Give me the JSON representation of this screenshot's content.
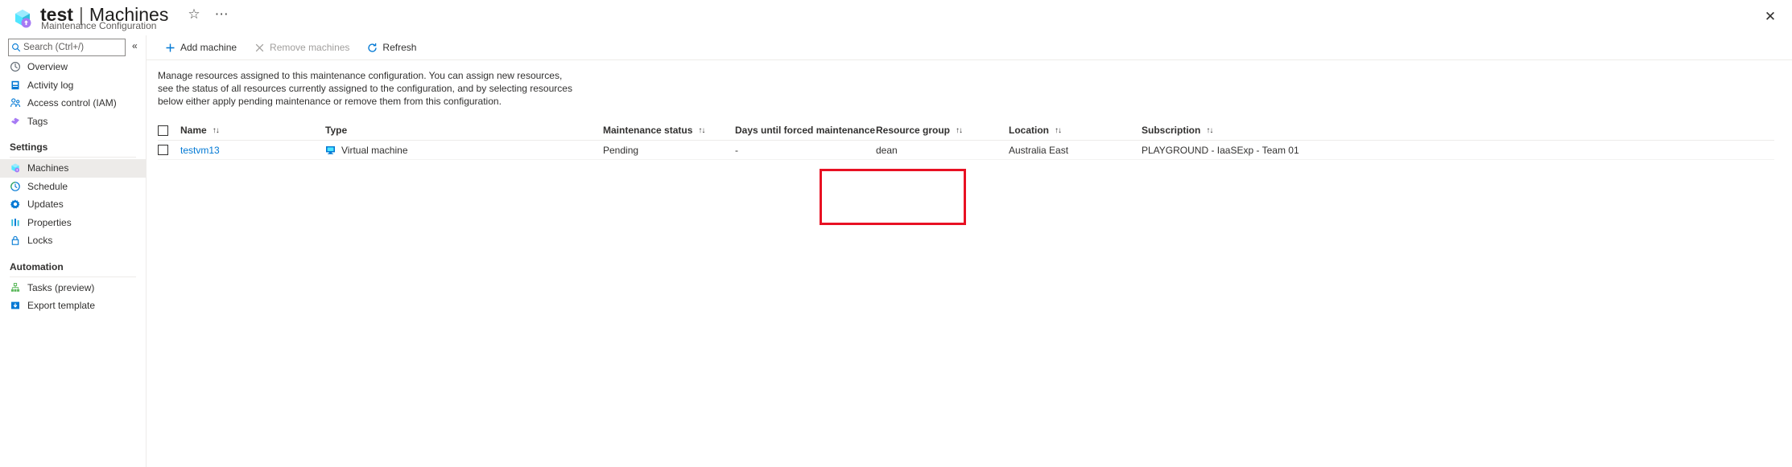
{
  "header": {
    "resource_icon": "maintenance-configuration-icon",
    "title": "test",
    "separator": "|",
    "section": "Machines",
    "subtitle": "Maintenance Configuration",
    "favorite_icon": "star-icon",
    "more_icon": "ellipsis-icon",
    "close_icon": "close-icon"
  },
  "sidebar": {
    "search": {
      "placeholder": "Search (Ctrl+/)",
      "value": "",
      "icon": "search-icon"
    },
    "collapse_icon": "chevron-double-left-icon",
    "items": [
      {
        "label": "Overview",
        "icon": "overview-icon",
        "selected": false
      },
      {
        "label": "Activity log",
        "icon": "activity-log-icon",
        "selected": false
      },
      {
        "label": "Access control (IAM)",
        "icon": "access-control-icon",
        "selected": false
      },
      {
        "label": "Tags",
        "icon": "tags-icon",
        "selected": false
      }
    ],
    "groups": [
      {
        "title": "Settings",
        "items": [
          {
            "label": "Machines",
            "icon": "machines-icon",
            "selected": true
          },
          {
            "label": "Schedule",
            "icon": "schedule-clock-icon",
            "selected": false
          },
          {
            "label": "Updates",
            "icon": "updates-gear-icon",
            "selected": false
          },
          {
            "label": "Properties",
            "icon": "properties-icon",
            "selected": false
          },
          {
            "label": "Locks",
            "icon": "lock-icon",
            "selected": false
          }
        ]
      },
      {
        "title": "Automation",
        "items": [
          {
            "label": "Tasks (preview)",
            "icon": "tasks-icon",
            "selected": false
          },
          {
            "label": "Export template",
            "icon": "export-template-icon",
            "selected": false
          }
        ]
      }
    ]
  },
  "toolbar": {
    "add_machine": {
      "label": "Add machine",
      "icon": "plus-icon",
      "disabled": false
    },
    "remove_machines": {
      "label": "Remove machines",
      "icon": "cross-icon",
      "disabled": true
    },
    "refresh": {
      "label": "Refresh",
      "icon": "refresh-icon",
      "disabled": false
    }
  },
  "description": "Manage resources assigned to this maintenance configuration. You can assign new resources, see the status of all resources currently assigned to the configuration, and by selecting resources below either apply pending maintenance or remove them from this configuration.",
  "table": {
    "sort_icon": "↑↓",
    "select_all_checkbox": false,
    "columns": [
      {
        "key": "name",
        "label": "Name",
        "sortable": true
      },
      {
        "key": "type",
        "label": "Type",
        "sortable": false
      },
      {
        "key": "status",
        "label": "Maintenance status",
        "sortable": true
      },
      {
        "key": "days",
        "label": "Days until forced maintenance",
        "sortable": true
      },
      {
        "key": "resource_group",
        "label": "Resource group",
        "sortable": true
      },
      {
        "key": "location",
        "label": "Location",
        "sortable": true
      },
      {
        "key": "subscription",
        "label": "Subscription",
        "sortable": true
      }
    ],
    "rows": [
      {
        "checked": false,
        "name": "testvm13",
        "type": "Virtual machine",
        "type_icon": "virtual-machine-icon",
        "status": "Pending",
        "days": "-",
        "resource_group": "dean",
        "location": "Australia East",
        "subscription": "PLAYGROUND - IaaSExp - Team 01"
      }
    ]
  },
  "annotation": {
    "color": "#e81123",
    "target": "maintenance-status-column"
  }
}
